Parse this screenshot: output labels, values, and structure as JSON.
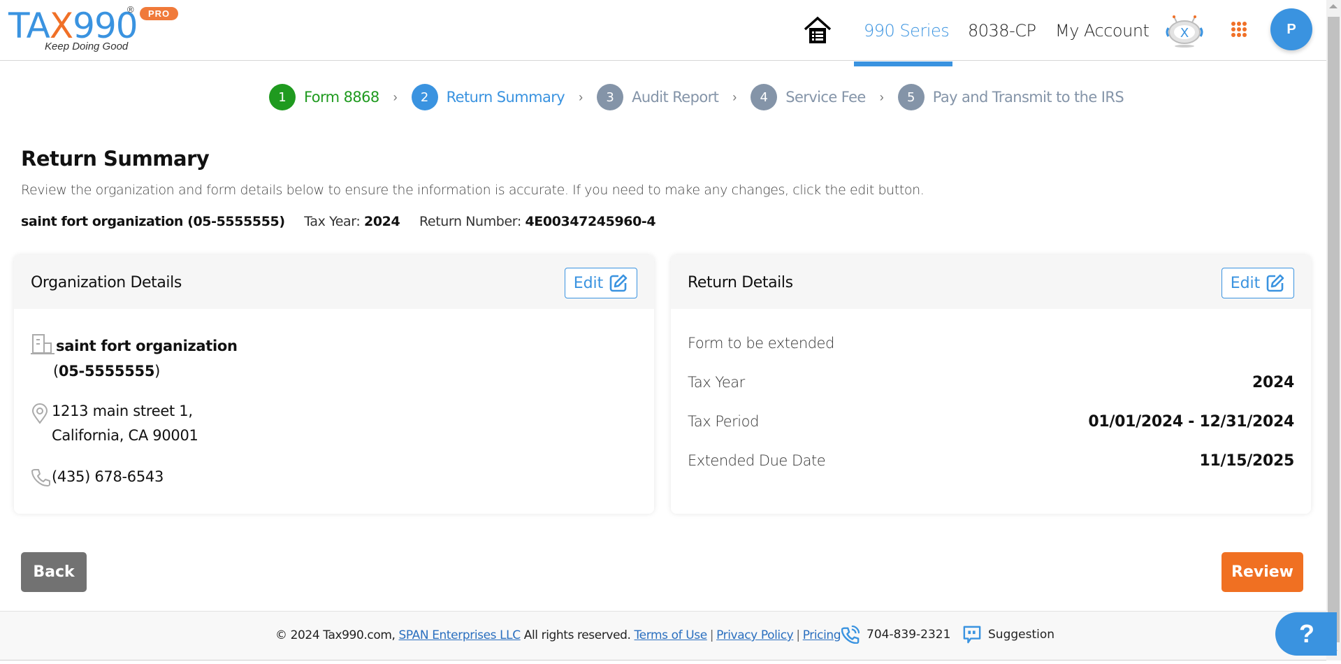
{
  "header": {
    "logo_text_a": "TA",
    "logo_text_x": "X",
    "logo_text_b": "990",
    "logo_registered": "®",
    "logo_badge": "PRO",
    "logo_tagline": "Keep Doing Good",
    "nav": [
      {
        "label": "990 Series",
        "active": true
      },
      {
        "label": "8038-CP",
        "active": false
      },
      {
        "label": "My Account",
        "active": false
      }
    ],
    "avatar_initial": "P",
    "icons": {
      "home": "home-list-icon",
      "assistant": "robot-assistant-icon",
      "apps": "apps-grid-icon"
    }
  },
  "stepper": {
    "steps": [
      {
        "num": "1",
        "label": "Form 8868",
        "state": "done"
      },
      {
        "num": "2",
        "label": "Return Summary",
        "state": "current"
      },
      {
        "num": "3",
        "label": "Audit Report",
        "state": "todo"
      },
      {
        "num": "4",
        "label": "Service Fee",
        "state": "todo"
      },
      {
        "num": "5",
        "label": "Pay and Transmit to the IRS",
        "state": "todo"
      }
    ],
    "separator": "›"
  },
  "page": {
    "title": "Return Summary",
    "description": "Review the organization and form details below to ensure the information is accurate. If you need to make any changes, click the edit button.",
    "org_summary": "saint fort organization (05-5555555)",
    "tax_year_label": "Tax Year:",
    "tax_year_value": "2024",
    "return_number_label": "Return Number:",
    "return_number_value": "4E00347245960-4"
  },
  "org_card": {
    "title": "Organization Details",
    "edit_label": "Edit",
    "name": "saint fort organization",
    "ein_open": "(",
    "ein": "05-5555555",
    "ein_close": ")",
    "address_line1": "1213 main street 1,",
    "address_line2": "California, CA 90001",
    "phone": "(435) 678-6543"
  },
  "return_card": {
    "title": "Return Details",
    "edit_label": "Edit",
    "form_to_extend_label": "Form to be extended",
    "rows": [
      {
        "label": "Tax Year",
        "value": "2024"
      },
      {
        "label": "Tax Period",
        "value": "01/01/2024 - 12/31/2024"
      },
      {
        "label": "Extended Due Date",
        "value": "11/15/2025"
      }
    ]
  },
  "actions": {
    "back_label": "Back",
    "review_label": "Review"
  },
  "footer": {
    "copyright": "© 2024 Tax990.com,",
    "company_link": "SPAN Enterprises LLC",
    "rights": "All rights reserved.",
    "terms_link": "Terms of Use",
    "privacy_link": "Privacy Policy",
    "pricing_link": "Pricing",
    "separator": "|",
    "phone": "704-839-2321",
    "suggestion": "Suggestion",
    "help_label": "?"
  },
  "colors": {
    "brand_blue": "#3a93e0",
    "brand_orange": "#f07022",
    "step_done": "#1f9a1f",
    "step_todo": "#8494a8",
    "back_button": "#727272"
  }
}
